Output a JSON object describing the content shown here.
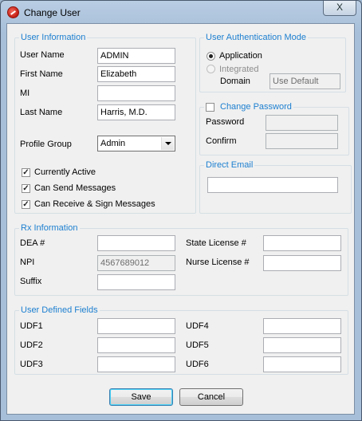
{
  "window": {
    "title": "Change User",
    "close_label": "X"
  },
  "user_info": {
    "legend": "User Information",
    "user_name": {
      "label": "User Name",
      "value": "ADMIN"
    },
    "first_name": {
      "label": "First Name",
      "value": "Elizabeth"
    },
    "mi": {
      "label": "MI",
      "value": ""
    },
    "last_name": {
      "label": "Last Name",
      "value": "Harris, M.D."
    },
    "profile_group": {
      "label": "Profile Group",
      "value": "Admin"
    },
    "checkboxes": [
      {
        "label": "Currently Active",
        "checked": true
      },
      {
        "label": "Can Send Messages",
        "checked": true
      },
      {
        "label": "Can Receive & Sign Messages",
        "checked": true
      }
    ]
  },
  "auth_mode": {
    "legend": "User Authentication Mode",
    "application_label": "Application",
    "integrated_label": "Integrated",
    "domain_label": "Domain",
    "domain_value": "Use Default",
    "selected": "Application"
  },
  "change_password": {
    "legend": "Change Password",
    "checked": false,
    "password_label": "Password",
    "confirm_label": "Confirm"
  },
  "direct_email": {
    "legend": "Direct Email",
    "value": ""
  },
  "rx_info": {
    "legend": "Rx Information",
    "dea_label": "DEA #",
    "dea_value": "",
    "npi_label": "NPI",
    "npi_value": "4567689012",
    "suffix_label": "Suffix",
    "suffix_value": "",
    "state_license_label": "State License #",
    "state_license_value": "",
    "nurse_license_label": "Nurse License #",
    "nurse_license_value": ""
  },
  "udf": {
    "legend": "User Defined Fields",
    "fields": [
      {
        "label": "UDF1",
        "value": ""
      },
      {
        "label": "UDF2",
        "value": ""
      },
      {
        "label": "UDF3",
        "value": ""
      },
      {
        "label": "UDF4",
        "value": ""
      },
      {
        "label": "UDF5",
        "value": ""
      },
      {
        "label": "UDF6",
        "value": ""
      }
    ]
  },
  "buttons": {
    "save": "Save",
    "cancel": "Cancel"
  }
}
